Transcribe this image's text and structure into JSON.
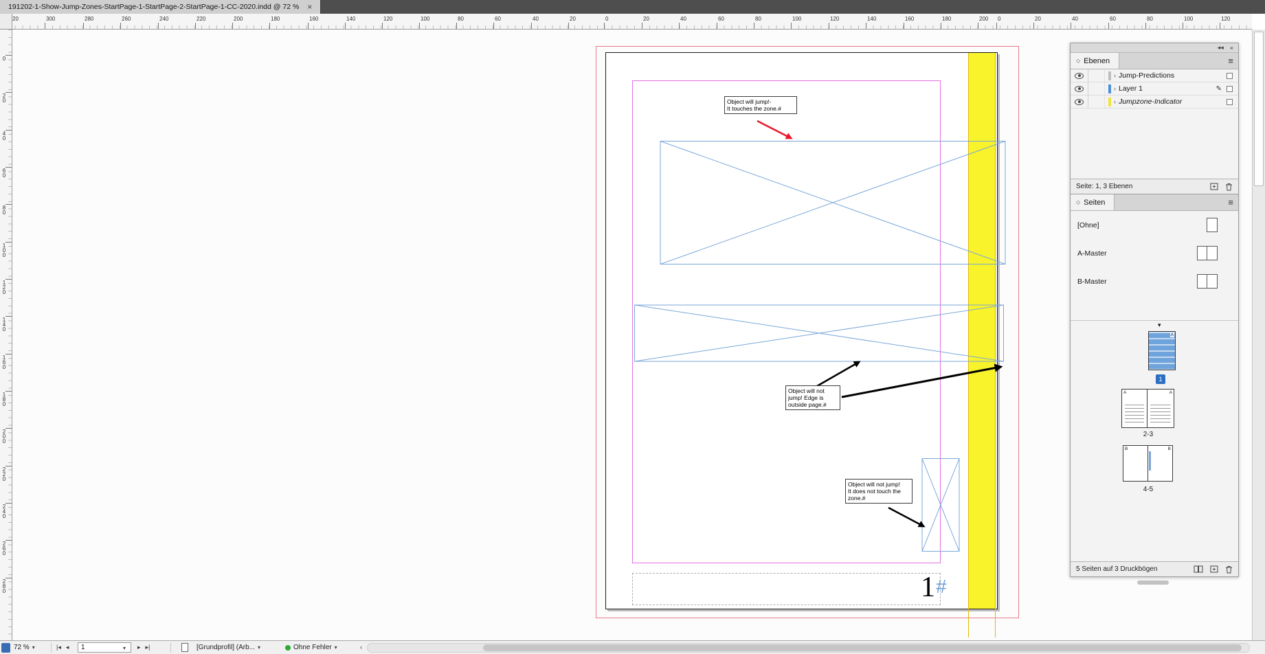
{
  "titlebar": {
    "tab_title": "191202-1-Show-Jump-Zones-StartPage-1-StartPage-2-StartPage-1-CC-2020.indd @ 72 %",
    "close_label": "×"
  },
  "icons": {
    "panel_collapse": "◂◂",
    "panel_close": "×",
    "panel_menu": "≡",
    "panel_tab_diamond": "◇",
    "dropdown": "▾",
    "expander": "›",
    "pen": "✎",
    "spread_marker": "▾",
    "nav_first": "|◂",
    "nav_prev": "◂",
    "nav_next": "▸",
    "nav_last": "▸|",
    "scroll_left": "‹"
  },
  "rulers": {
    "horizontal_labels": [
      "20",
      "300",
      "280",
      "260",
      "240",
      "220",
      "200",
      "180",
      "160",
      "140",
      "120",
      "100",
      "80",
      "60",
      "40",
      "20",
      "0",
      "20",
      "40",
      "60",
      "80",
      "100",
      "120",
      "140",
      "160",
      "180",
      "200",
      "0",
      "20",
      "40",
      "60",
      "80",
      "100",
      "120"
    ],
    "vertical_labels": [
      "0",
      "20",
      "40",
      "60",
      "80",
      "100",
      "120",
      "140",
      "160",
      "180",
      "200",
      "220",
      "240",
      "260",
      "280"
    ]
  },
  "document": {
    "callouts": {
      "jump": {
        "lines": [
          "Object will jump!-",
          "It touches the zone.#"
        ]
      },
      "no_jump_edge": {
        "lines": [
          "Object will not",
          "jump! Edge is",
          "outside page.#"
        ]
      },
      "no_jump_zone": {
        "lines": [
          "Object will not jump!",
          "It does not touch the",
          "zone.#"
        ]
      }
    },
    "page_number": {
      "numeral": "1",
      "marker": "#"
    },
    "colors": {
      "jumpzone": "#f8f32b",
      "frame": "#7aa7d9",
      "margin_guide": "#e36ee3",
      "bleed_guide": "#e87a8a",
      "column_guide": "#dfb900",
      "arrow_red": "#e8192c",
      "arrow_black": "#000000",
      "page_marker_blue": "#6d9fd8"
    }
  },
  "layers_panel": {
    "title": "Ebenen",
    "rows": [
      {
        "name": "Jump-Predictions",
        "color": "#bdbdbd",
        "active": false,
        "italic": false
      },
      {
        "name": "Layer 1",
        "color": "#4a90d9",
        "active": true,
        "italic": false
      },
      {
        "name": "Jumpzone-Indicator",
        "color": "#efe43a",
        "active": false,
        "italic": true
      }
    ],
    "status": "Seite: 1, 3 Ebenen"
  },
  "pages_panel": {
    "title": "Seiten",
    "masters": [
      "[Ohne]",
      "A-Master",
      "B-Master"
    ],
    "page1": {
      "letter": "A",
      "badge": "1",
      "thumb_fill": "#6fa3dc",
      "badge_color": "#2d6fc2"
    },
    "spread23": {
      "letters": [
        "A",
        "A"
      ],
      "label": "2-3"
    },
    "spread45": {
      "letters": [
        "B",
        "B"
      ],
      "label": "4-5"
    },
    "status": "5 Seiten auf 3 Druckbögen"
  },
  "statusbar": {
    "zoom": "72 %",
    "page_value": "1",
    "profile": "[Grundprofil] (Arb...",
    "preflight": "Ohne Fehler"
  }
}
